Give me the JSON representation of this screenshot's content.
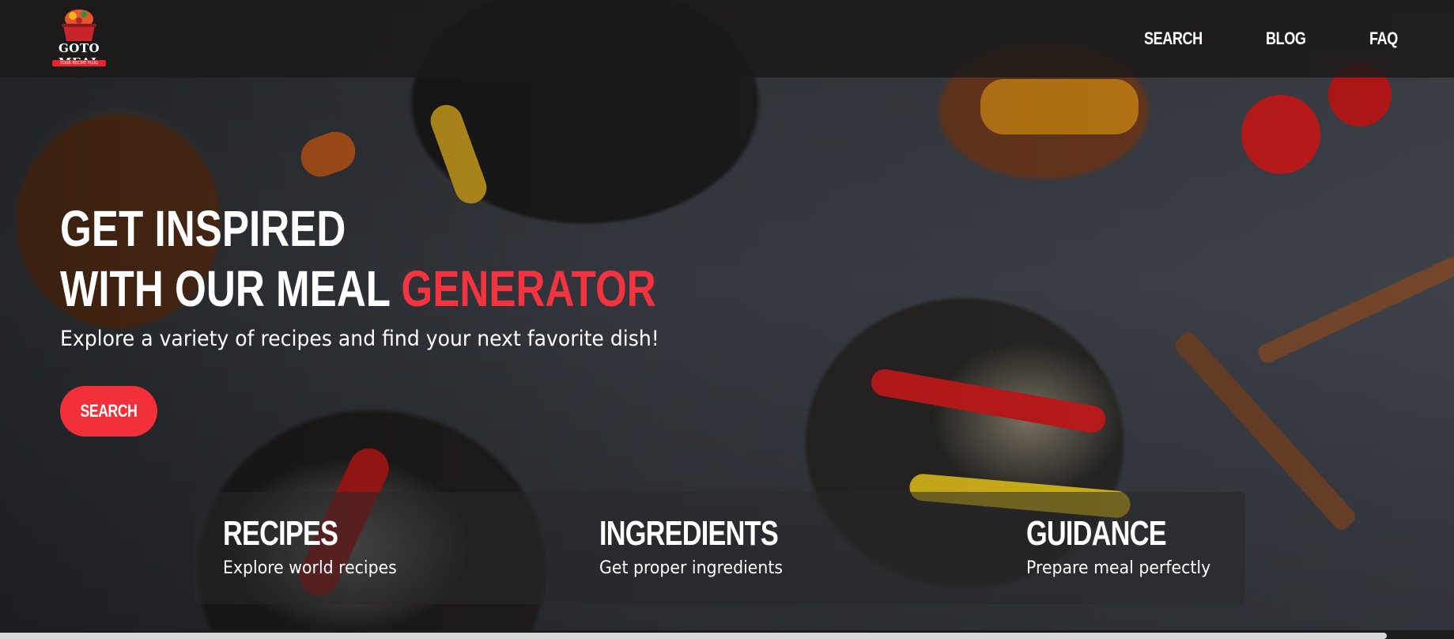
{
  "brand": {
    "logo_word_1": "GOTO",
    "logo_word_2": "MEAL",
    "logo_tagline": "YOUR RECIPE PLUG"
  },
  "nav": {
    "items": [
      {
        "label": "SEARCH"
      },
      {
        "label": "BLOG"
      },
      {
        "label": "FAQ"
      }
    ]
  },
  "hero": {
    "headline_line1": "GET INSPIRED",
    "headline_line2": "WITH OUR MEAL",
    "headline_accent": "GENERATOR",
    "subtitle": "Explore a variety of recipes and find your next favorite dish!",
    "cta_label": "SEARCH"
  },
  "features": [
    {
      "title": "RECIPES",
      "description": "Explore world recipes"
    },
    {
      "title": "INGREDIENTS",
      "description": "Get proper ingredients"
    },
    {
      "title": "GUIDANCE",
      "description": "Prepare meal perfectly"
    }
  ],
  "colors": {
    "accent": "#f23440",
    "topbar": "#1c1a18",
    "text": "#ffffff"
  }
}
